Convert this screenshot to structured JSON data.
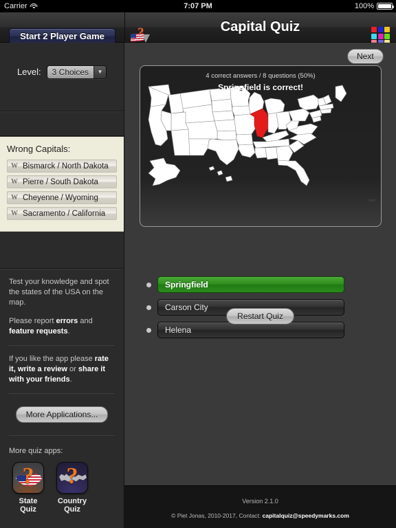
{
  "status_bar": {
    "carrier": "Carrier",
    "wifi_icon": "wifi-icon",
    "time": "7:07 PM",
    "battery_percent": "100%",
    "battery_icon": "battery-full-icon"
  },
  "navbar": {
    "start_two_player_label": "Start 2 Player Game",
    "app_logo_icon": "flag-question-logo-icon",
    "title": "Capital Quiz",
    "grid_logo_icon": "color-grid-icon",
    "grid_colors": [
      "#e8202a",
      "#1826d8",
      "#f2c420",
      "#3fd9e8",
      "#e023b4",
      "#62dd1e",
      "#f08090",
      "#6f63e0",
      "#f3eb8a"
    ]
  },
  "sidebar": {
    "level": {
      "label": "Level:",
      "value": "3 Choices",
      "chevron_icon": "chevron-down-icon"
    },
    "wrong_capitals": {
      "title": "Wrong Capitals:",
      "marker": "W",
      "items": [
        "Bismarck / North Dakota",
        "Pierre / South Dakota",
        "Cheyenne / Wyoming",
        "Sacramento / California"
      ]
    },
    "info": {
      "p1_plain": "Test your knowledge and spot the states of the USA on the map.",
      "p2_prefix": "Please report ",
      "p2_bold1": "errors",
      "p2_mid": " and ",
      "p2_bold2": "feature requests",
      "p2_suffix": ".",
      "p3_prefix": "If you like the app please ",
      "p3_bold1": "rate it, write a review",
      "p3_mid": " or ",
      "p3_bold2": "share it with your friends",
      "p3_suffix": "."
    },
    "more_applications_label": "More Applications...",
    "more_quiz_apps_label": "More quiz apps:",
    "apps": [
      {
        "name": "State Quiz",
        "icon": "state-quiz-app-icon",
        "qmark": "?"
      },
      {
        "name": "Country Quiz",
        "icon": "country-quiz-app-icon",
        "qmark": "?"
      }
    ]
  },
  "main": {
    "map": {
      "score_text": "4 correct answers / 8 questions (50%)",
      "result_text": "Springfield is correct!",
      "highlighted_state": "Illinois",
      "highlight_color": "#e31b1b",
      "state_fill": "#ffffff",
      "credit": "Map"
    },
    "answers": [
      {
        "label": "Springfield",
        "state": "correct"
      },
      {
        "label": "Carson City",
        "state": "default"
      },
      {
        "label": "Helena",
        "state": "default"
      }
    ],
    "next_label": "Next",
    "restart_label": "Restart Quiz"
  },
  "footer": {
    "version": "Version 2.1.0",
    "copyright_prefix": "© Piet Jonas, 2010-2017, Contact: ",
    "contact_email": "capitalquiz@speedymarks.com"
  }
}
